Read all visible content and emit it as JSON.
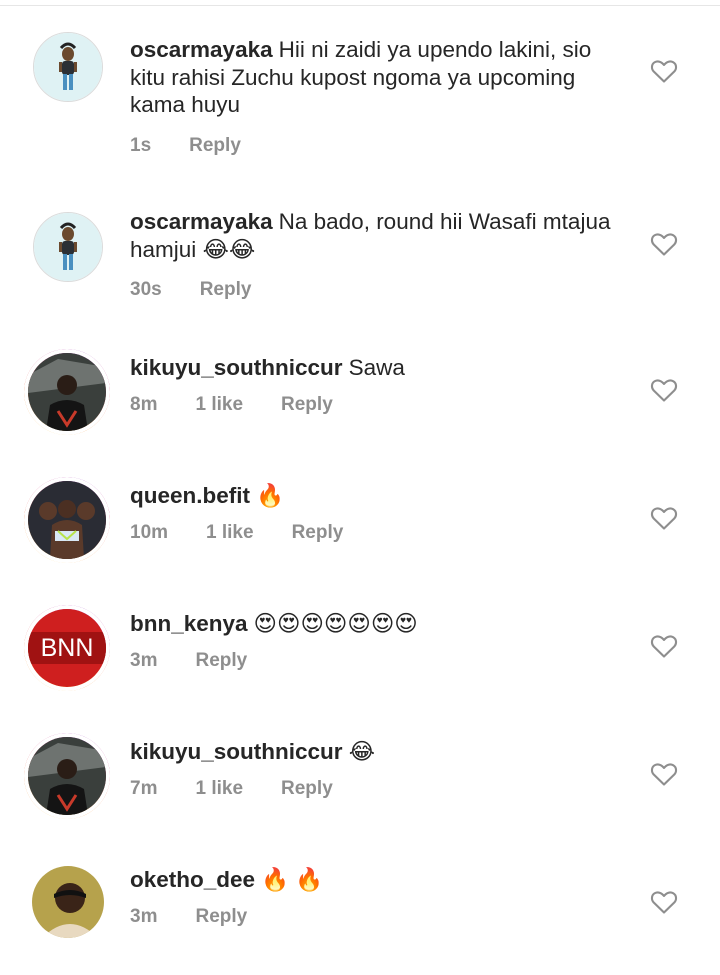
{
  "comments": [
    {
      "username": "oscarmayaka",
      "text": "Hii ni zaidi ya upendo lakini, sio kitu rahisi Zuchu kupost ngoma ya upcoming kama huyu",
      "time": "1s",
      "likes": "",
      "reply": "Reply",
      "avatar": "cartoon-avatar"
    },
    {
      "username": "oscarmayaka",
      "text": "Na bado, round hii Wasafi mtajua hamjui 😂😂",
      "time": "30s",
      "likes": "",
      "reply": "Reply",
      "avatar": "cartoon-avatar"
    },
    {
      "username": "kikuyu_southniccur",
      "text": "Sawa",
      "time": "8m",
      "likes": "1 like",
      "reply": "Reply",
      "avatar": "photo-avatar"
    },
    {
      "username": "queen.befit",
      "text": "🔥",
      "time": "10m",
      "likes": "1 like",
      "reply": "Reply",
      "avatar": "photo-avatar"
    },
    {
      "username": "bnn_kenya",
      "text": "😍😍😍😍😍😍😍",
      "time": "3m",
      "likes": "",
      "reply": "Reply",
      "avatar": "logo-avatar",
      "logo_text": "BNN"
    },
    {
      "username": "kikuyu_southniccur",
      "text": "😂",
      "time": "7m",
      "likes": "1 like",
      "reply": "Reply",
      "avatar": "photo-avatar"
    },
    {
      "username": "oketho_dee",
      "text": "🔥 🔥",
      "time": "3m",
      "likes": "",
      "reply": "Reply",
      "avatar": "photo-avatar"
    }
  ],
  "icons": {
    "like": "heart-outline-icon"
  },
  "colors": {
    "text": "#262626",
    "meta": "#8e8e8e",
    "story_ring": [
      "#feda75",
      "#fa7e1e",
      "#d62976",
      "#962fbf"
    ]
  }
}
